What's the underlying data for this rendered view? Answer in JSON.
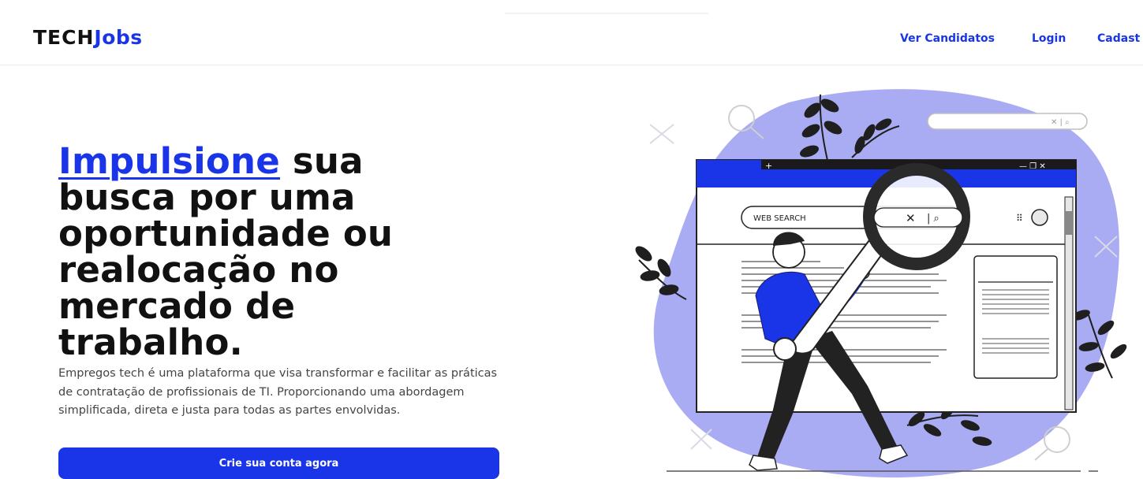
{
  "header": {
    "logo_part1": "TECH",
    "logo_part2": "Jobs",
    "nav": [
      {
        "label": "Ver Candidatos"
      },
      {
        "label": "Login"
      },
      {
        "label": "Cadast"
      }
    ]
  },
  "hero": {
    "headline_accent": "Impulsione",
    "headline_rest_1": " sua",
    "headline_rest_2": "busca por uma",
    "headline_rest_3": "oportunidade ou",
    "headline_rest_4": "realocação no",
    "headline_rest_5": "mercado de",
    "headline_rest_6": "trabalho.",
    "description": "Empregos tech é uma plataforma que visa transformar e facilitar as práticas de contratação de profissionais de TI. Proporcionando uma abordagem simplificada, direta e justa para todas as partes envolvidas.",
    "cta_label": "Crie sua conta agora"
  },
  "illustration": {
    "search_label": "WEB SEARCH",
    "colors": {
      "accent": "#1a35e8",
      "blob": "#a9acf2",
      "shirt": "#1a35e8",
      "dark": "#222222"
    }
  }
}
